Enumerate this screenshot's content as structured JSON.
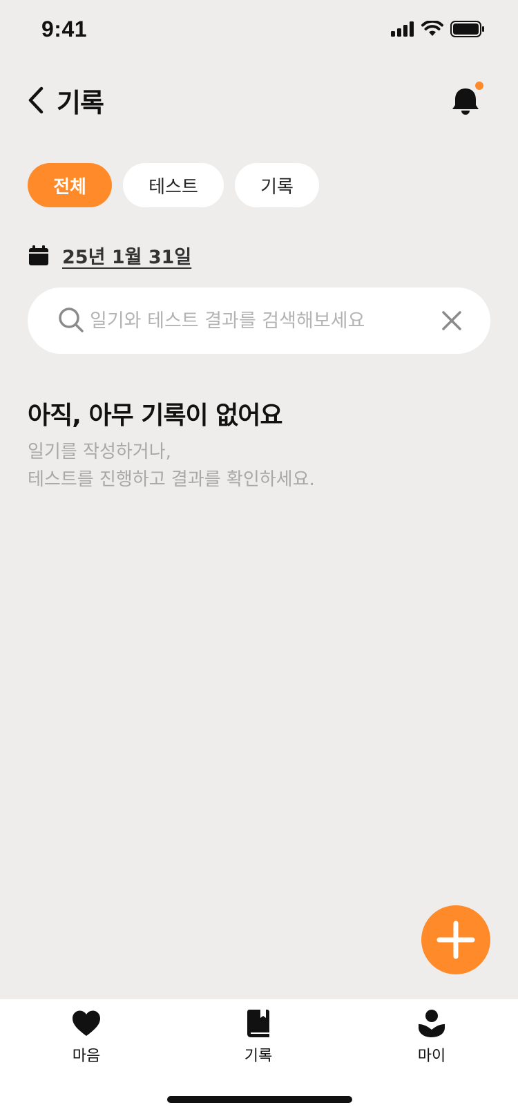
{
  "status_bar": {
    "time": "9:41"
  },
  "header": {
    "title": "기록"
  },
  "filters": [
    {
      "label": "전체",
      "active": true
    },
    {
      "label": "테스트",
      "active": false
    },
    {
      "label": "기록",
      "active": false
    }
  ],
  "date": {
    "text": "25년 1월 31일"
  },
  "search": {
    "placeholder": "일기와 테스트 결과를 검색해보세요",
    "value": ""
  },
  "empty_state": {
    "title": "아직, 아무 기록이 없어요",
    "line1": "일기를 작성하거나,",
    "line2": "테스트를 진행하고 결과를 확인하세요."
  },
  "tab_bar": {
    "items": [
      {
        "label": "마음",
        "icon": "heart-icon"
      },
      {
        "label": "기록",
        "icon": "book-icon"
      },
      {
        "label": "마이",
        "icon": "person-icon"
      }
    ]
  },
  "colors": {
    "accent": "#FF8A2A",
    "background": "#EEEDEC",
    "surface": "#FFFFFF"
  }
}
